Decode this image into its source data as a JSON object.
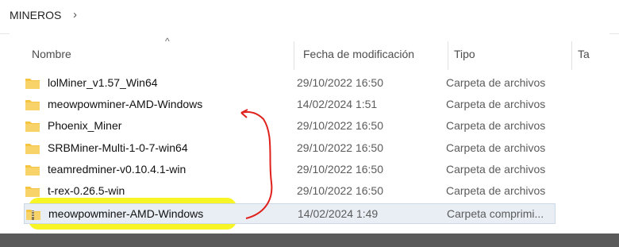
{
  "breadcrumb": {
    "folder": "MINEROS",
    "chevron_icon": "chevron-right-icon"
  },
  "columns": {
    "name": "Nombre",
    "date": "Fecha de modificación",
    "type": "Tipo",
    "size_partial": "Ta"
  },
  "rows": [
    {
      "name": "lolMiner_v1.57_Win64",
      "date": "29/10/2022 16:50",
      "type": "Carpeta de archivos",
      "icon": "folder-icon"
    },
    {
      "name": "meowpowminer-AMD-Windows",
      "date": "14/02/2024 1:51",
      "type": "Carpeta de archivos",
      "icon": "folder-icon"
    },
    {
      "name": "Phoenix_Miner",
      "date": "29/10/2022 16:50",
      "type": "Carpeta de archivos",
      "icon": "folder-icon"
    },
    {
      "name": "SRBMiner-Multi-1-0-7-win64",
      "date": "29/10/2022 16:50",
      "type": "Carpeta de archivos",
      "icon": "folder-icon"
    },
    {
      "name": "teamredminer-v0.10.4.1-win",
      "date": "29/10/2022 16:50",
      "type": "Carpeta de archivos",
      "icon": "folder-icon"
    },
    {
      "name": "t-rex-0.26.5-win",
      "date": "29/10/2022 16:50",
      "type": "Carpeta de archivos",
      "icon": "folder-icon"
    },
    {
      "name": "meowpowminer-AMD-Windows",
      "date": "14/02/2024 1:49",
      "type": "Carpeta comprimi...",
      "icon": "zip-folder-icon"
    }
  ],
  "colors": {
    "folder": "#f5c542",
    "highlight": "#f7f300",
    "annotation_arrow": "#e0201b"
  }
}
